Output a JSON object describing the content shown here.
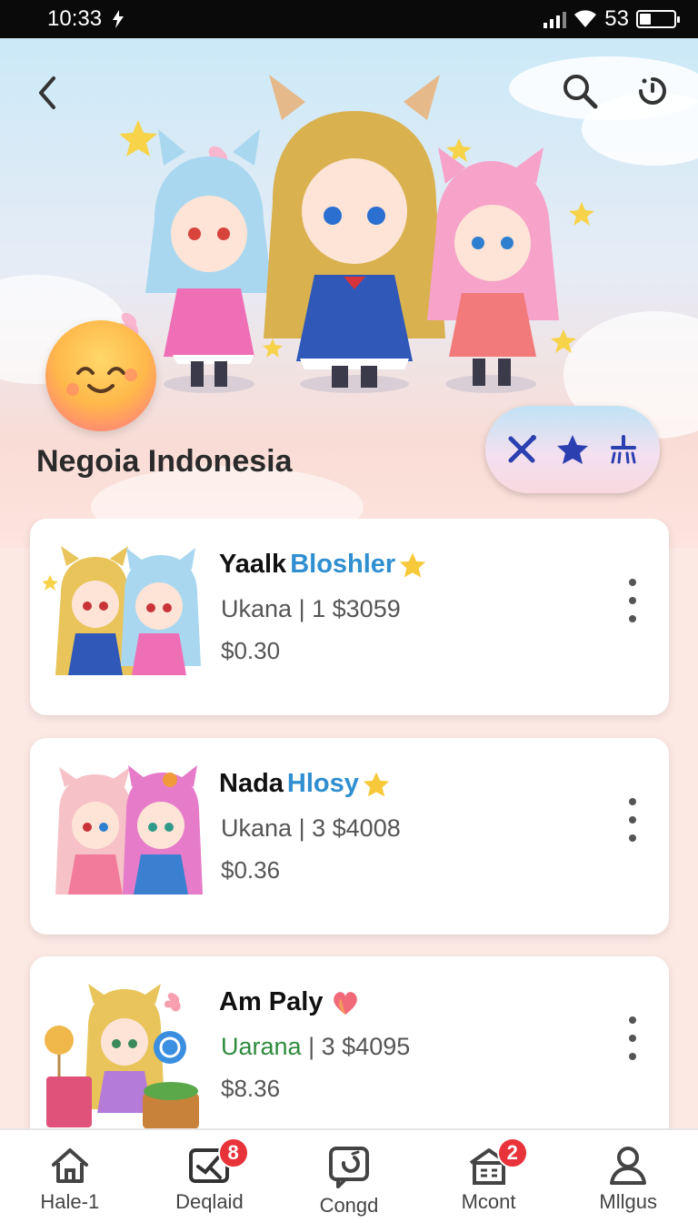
{
  "status": {
    "time": "10:33",
    "battery": "53"
  },
  "header": {
    "title": "Negoia Indonesia"
  },
  "icons": {
    "back": "back-arrow-icon",
    "search": "search-icon",
    "history": "history-icon",
    "pill": [
      "tool-icon",
      "star-icon",
      "broom-icon"
    ]
  },
  "items": [
    {
      "name": "Yaalk",
      "name_hl": "Bloshler",
      "badge": "star",
      "source": "Ukana",
      "sep": "|",
      "count": "1",
      "amount": "$3059",
      "price": "$0.30",
      "source_color": "#555555"
    },
    {
      "name": "Nada",
      "name_hl": "Hlosy",
      "badge": "star",
      "source": "Ukana",
      "sep": "|",
      "count": "3",
      "amount": "$4008",
      "price": "$0.36",
      "source_color": "#555555"
    },
    {
      "name": "Am Paly",
      "name_hl": "",
      "badge": "heart",
      "source": "Uarana",
      "sep": "|",
      "count": "3",
      "amount": "$4095",
      "price": "$8.36",
      "source_color": "#2e8b3e"
    }
  ],
  "tabs": [
    {
      "label": "Hale-1",
      "icon": "home-icon",
      "badge": ""
    },
    {
      "label": "Deqlaid",
      "icon": "tools-icon",
      "badge": "8"
    },
    {
      "label": "Congd",
      "icon": "chat-icon",
      "badge": ""
    },
    {
      "label": "Mcont",
      "icon": "store-icon",
      "badge": "2"
    },
    {
      "label": "Mllgus",
      "icon": "profile-icon",
      "badge": ""
    }
  ],
  "colors": {
    "accent": "#2f8fd0",
    "badge": "#e8333a",
    "star": "#f7c93a"
  }
}
